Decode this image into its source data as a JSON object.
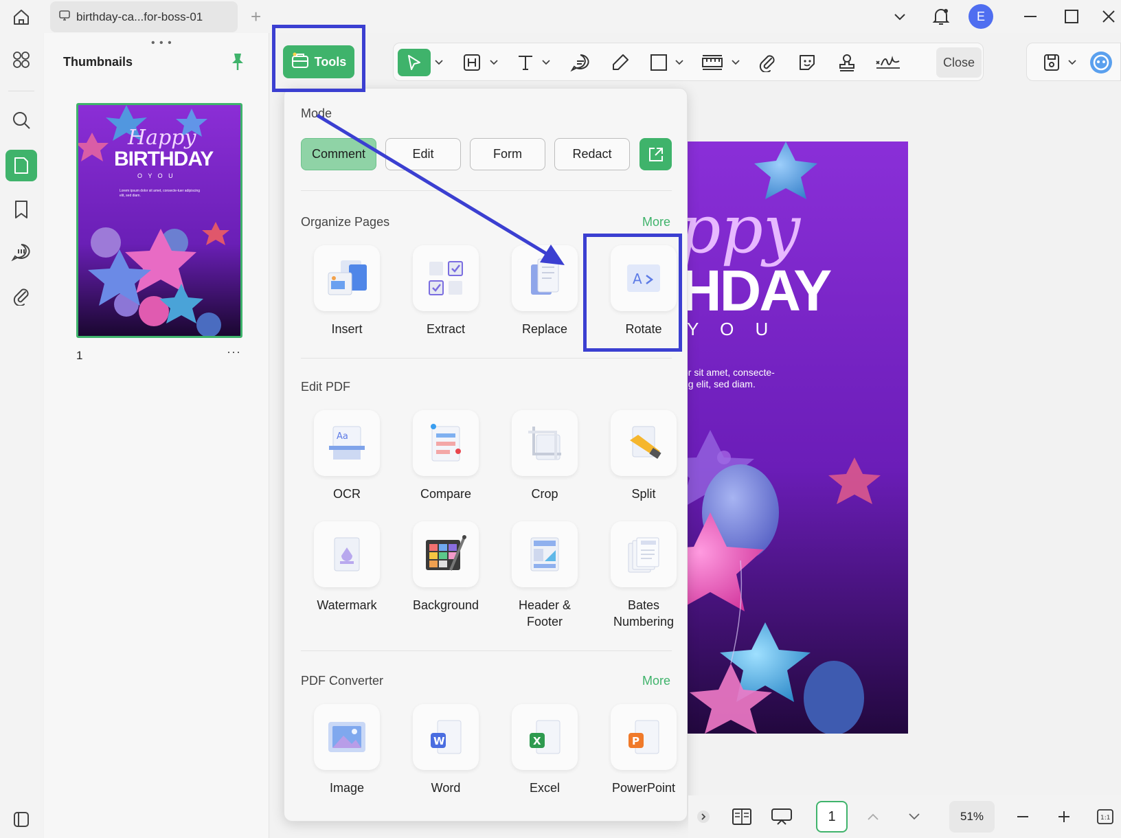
{
  "app": {
    "tab_title": "birthday-ca...for-boss-01",
    "avatar_letter": "E",
    "accent_color": "#3fb36b",
    "highlight_color": "#3b3fd1"
  },
  "sidebar_panel": {
    "title": "Thumbnails",
    "page_number": "1",
    "more_label": "···"
  },
  "toolbar": {
    "tools_label": "Tools",
    "close_label": "Close",
    "icons": [
      "pointer-icon",
      "highlight-icon",
      "text-icon",
      "comment-icon",
      "pen-icon",
      "rectangle-icon",
      "measure-icon",
      "attachment-icon",
      "sticker-icon",
      "stamp-icon",
      "signature-icon"
    ]
  },
  "popup": {
    "mode_title": "Mode",
    "modes": [
      {
        "label": "Comment",
        "active": true
      },
      {
        "label": "Edit",
        "active": false
      },
      {
        "label": "Form",
        "active": false
      },
      {
        "label": "Redact",
        "active": false
      }
    ],
    "organize": {
      "title": "Organize Pages",
      "more": "More",
      "items": [
        "Insert",
        "Extract",
        "Replace",
        "Rotate"
      ]
    },
    "edit_pdf": {
      "title": "Edit PDF",
      "items": [
        "OCR",
        "Compare",
        "Crop",
        "Split",
        "Watermark",
        "Background",
        "Header &\nFooter",
        "Bates\nNumbering"
      ]
    },
    "converter": {
      "title": "PDF Converter",
      "more": "More",
      "items": [
        "Image",
        "Word",
        "Excel",
        "PowerPoint"
      ]
    }
  },
  "document": {
    "visible_text_1": "ppy",
    "visible_text_2": "HDAY",
    "visible_text_3": "Y O U",
    "visible_text_4": "or sit amet, consecte-",
    "visible_text_5": "ng elit, sed diam.",
    "thumb_title_1": "Happy",
    "thumb_title_2": "BIRTHDAY",
    "thumb_title_3": "O  Y O U",
    "thumb_body": "Lorem ipsum dolor sit amet, consecte-tuer adipiscing elit, sed diam."
  },
  "statusbar": {
    "page_value": "1",
    "zoom": "51%"
  }
}
